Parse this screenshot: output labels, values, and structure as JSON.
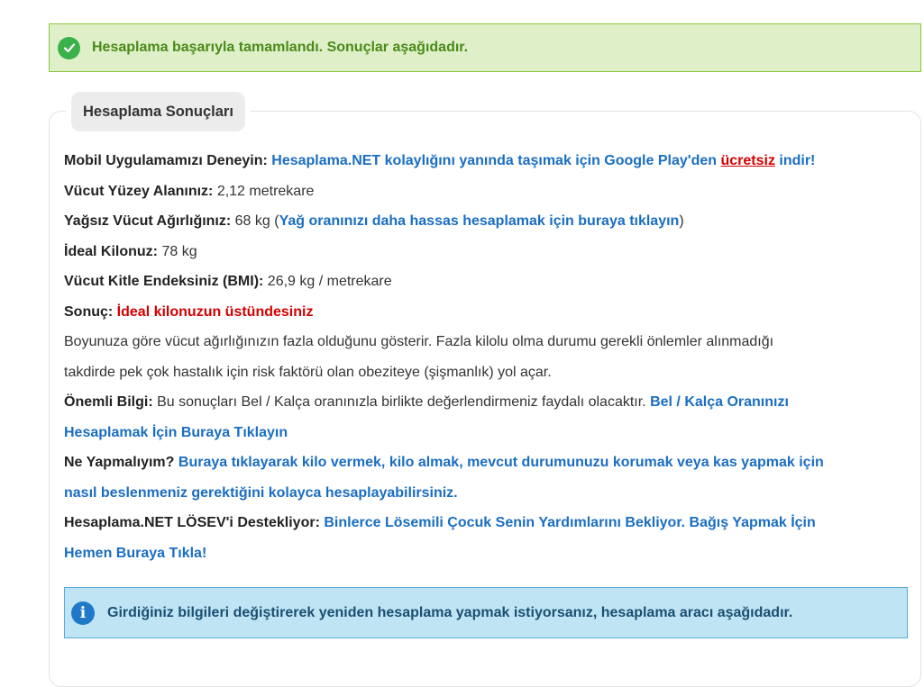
{
  "success_alert": {
    "icon": "check-circle-icon",
    "text": "Hesaplama başarıyla tamamlandı. Sonuçlar aşağıdadır."
  },
  "panel": {
    "title": "Hesaplama Sonuçları",
    "app_promo": {
      "label": "Mobil Uygulamamızı Deneyin:",
      "link_text": "Hesaplama.NET kolaylığını yanında taşımak için Google Play'den",
      "free_text": "ücretsiz",
      "end_text": "indir!"
    },
    "body_surface": {
      "label": "Vücut Yüzey Alanınız:",
      "value": "2,12 metrekare"
    },
    "lean_mass": {
      "label": "Yağsız Vücut Ağırlığınız:",
      "value": "68 kg (",
      "link": "Yağ oranınızı daha hassas hesaplamak için buraya tıklayın",
      "close": ")"
    },
    "ideal_weight": {
      "label": "İdeal Kilonuz:",
      "value": "78 kg"
    },
    "bmi": {
      "label": "Vücut Kitle Endeksiniz (BMI):",
      "value": "26,9 kg / metrekare"
    },
    "result": {
      "label": "Sonuç:",
      "value": "İdeal kilonuzun üstündesiniz"
    },
    "explanation_line1": "Boyunuza göre vücut ağırlığınızın fazla olduğunu gösterir. Fazla kilolu olma durumu gerekli önlemler alınmadığı",
    "explanation_line2": "takdirde pek çok hastalık için risk faktörü olan obeziteye (şişmanlık) yol açar.",
    "important": {
      "label": "Önemli Bilgi:",
      "text": "Bu sonuçları Bel / Kalça oranınızla birlikte değerlendirmeniz faydalı olacaktır.",
      "link_line1": "Bel / Kalça Oranınızı",
      "link_line2": "Hesaplamak İçin Buraya Tıklayın"
    },
    "what_to_do": {
      "label": "Ne Yapmalıyım?",
      "link_line1": "Buraya tıklayarak kilo vermek, kilo almak, mevcut durumunuzu korumak veya kas yapmak için",
      "link_line2": "nasıl beslenmeniz gerektiğini kolayca hesaplayabilirsiniz."
    },
    "losev": {
      "label": "Hesaplama.NET LÖSEV'i Destekliyor:",
      "link_line1": "Binlerce Lösemili Çocuk Senin Yardımlarını Bekliyor. Bağış Yapmak İçin",
      "link_line2": "Hemen Buraya Tıkla!"
    }
  },
  "info_alert": {
    "icon": "info-circle-icon",
    "text": "Girdiğiniz bilgileri değiştirerek yeniden hesaplama yapmak istiyorsanız, hesaplama aracı aşağıdadır."
  },
  "colors": {
    "success_bg": "#dff0c8",
    "success_text": "#4a8a1a",
    "link": "#1a6ec2",
    "alert_red": "#d40000",
    "info_bg": "#bfe5f5"
  }
}
